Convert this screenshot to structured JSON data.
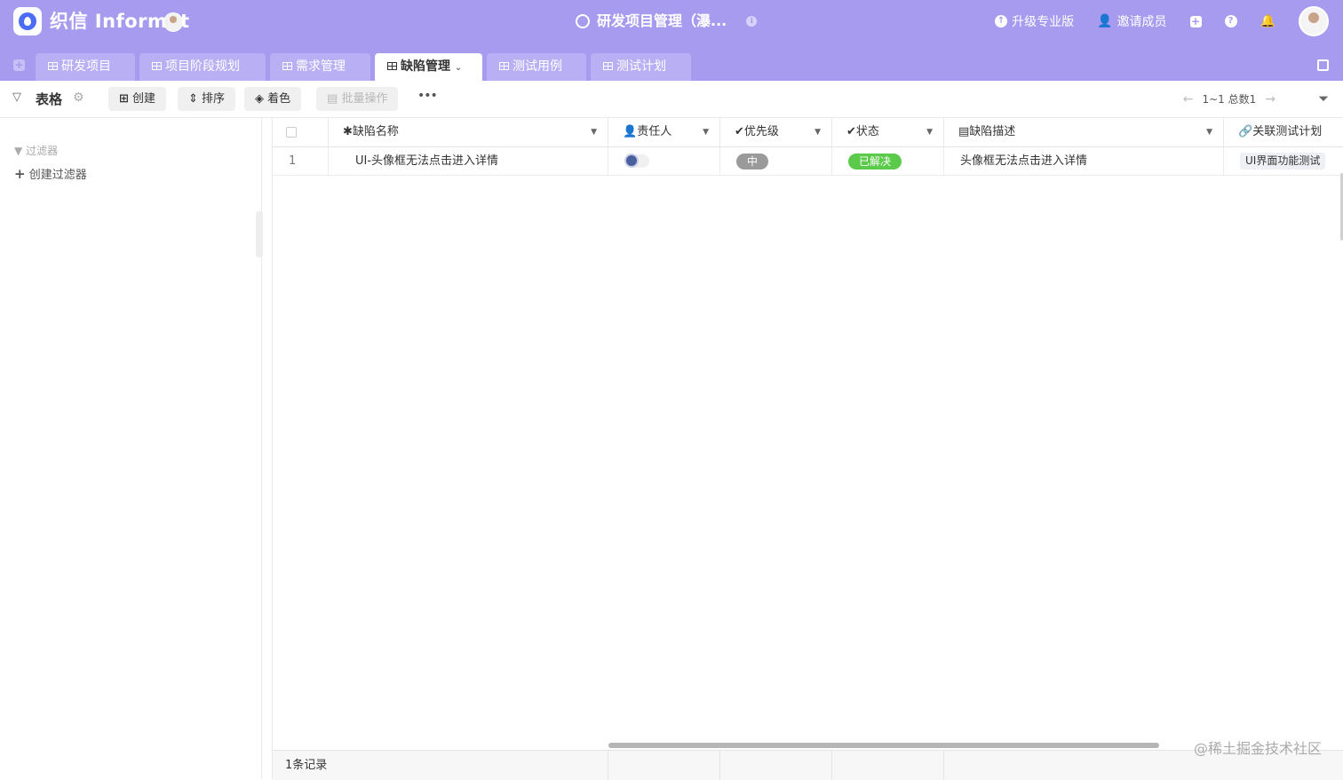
{
  "header": {
    "brand": "织信 Informat",
    "project_title": "研发项目管理（瀑...",
    "info_icon": "ℹ",
    "actions": [
      {
        "label": "升级专业版",
        "icon": "upload-icon"
      },
      {
        "label": "邀请成员",
        "icon": "add-user-icon"
      }
    ]
  },
  "tabs": [
    {
      "label": "研发项目",
      "active": false
    },
    {
      "label": "项目阶段规划",
      "active": false
    },
    {
      "label": "需求管理",
      "active": false
    },
    {
      "label": "缺陷管理",
      "active": true
    },
    {
      "label": "测试用例",
      "active": false
    },
    {
      "label": "测试计划",
      "active": false
    }
  ],
  "toolbar": {
    "view_label": "表格",
    "create_label": "创建",
    "sort_label": "排序",
    "color_label": "着色",
    "batch_label": "批量操作",
    "more_label": "•••",
    "pager_text": "1~1 总数1"
  },
  "sidebar": {
    "filter_label": "过滤器",
    "create_filter_label": "创建过滤器"
  },
  "table": {
    "columns": [
      {
        "label": "缺陷名称",
        "icon": "asterisk-icon"
      },
      {
        "label": "责任人",
        "icon": "user-check-icon"
      },
      {
        "label": "优先级",
        "icon": "check-circle-icon"
      },
      {
        "label": "状态",
        "icon": "check-circle-icon"
      },
      {
        "label": "缺陷描述",
        "icon": "document-icon"
      },
      {
        "label": "关联测试计划",
        "icon": "link-icon"
      }
    ],
    "rows": [
      {
        "index": "1",
        "name": "UI-头像框无法点击进入详情",
        "priority": "中",
        "status": "已解决",
        "description": "头像框无法点击进入详情",
        "linked_plan": "UI界面功能测试"
      }
    ],
    "footer": "1条记录"
  },
  "colors": {
    "header_bg": "#a79bf0",
    "priority_pill": "#9a9a9a",
    "status_pill": "#5bc94a"
  },
  "watermark": "@稀土掘金技术社区"
}
